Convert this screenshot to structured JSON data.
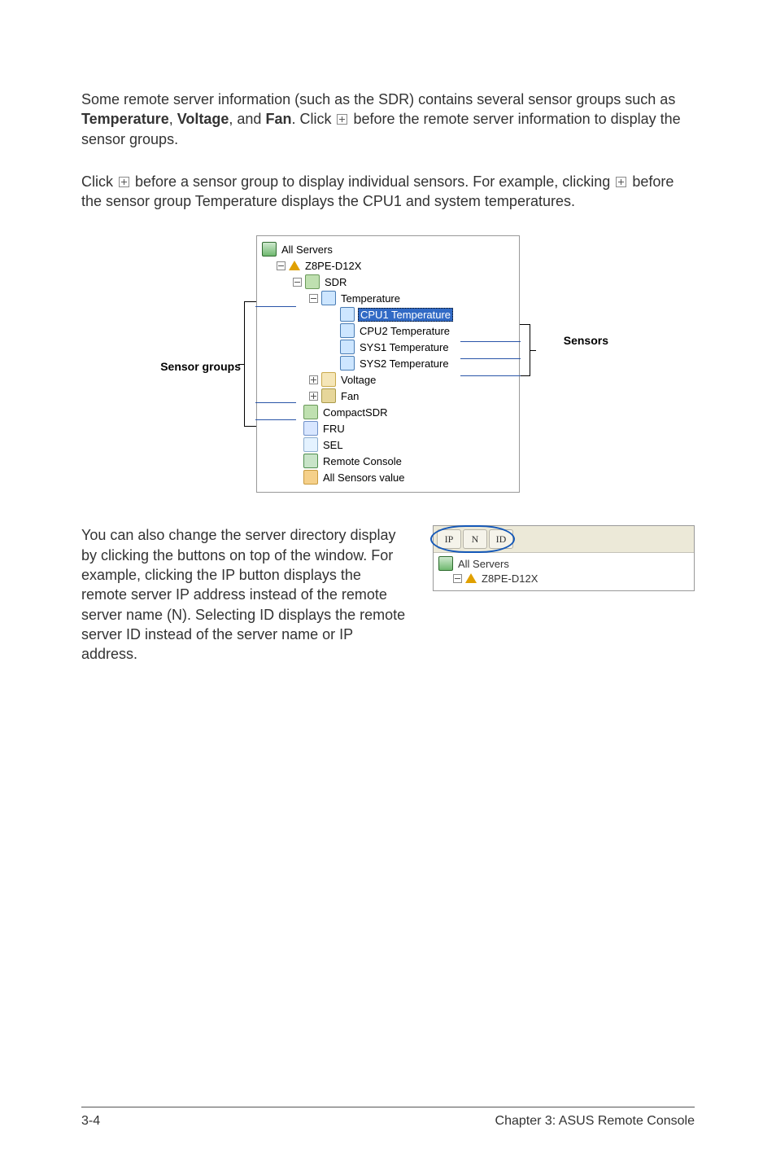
{
  "para1_pre": "Some remote server information (such as the SDR) contains several sensor groups such as ",
  "bold_temp": "Temperature",
  "sep1": ", ",
  "bold_volt": "Voltage",
  "sep2": ", and ",
  "bold_fan": "Fan",
  "para1_mid": ". Click ",
  "para1_post": " before the remote server information to display the sensor groups.",
  "para2_pre": "Click ",
  "para2_mid": " before a sensor group to display individual sensors. For example, clicking ",
  "para2_post": " before the sensor group Temperature displays the CPU1 and system temperatures.",
  "anno_left": "Sensor groups",
  "anno_right": "Sensors",
  "tree": {
    "root": "All Servers",
    "server": "Z8PE-D12X",
    "sdr": "SDR",
    "temperature": "Temperature",
    "cpu1": "CPU1 Temperature",
    "cpu2": "CPU2 Temperature",
    "sys1": "SYS1 Temperature",
    "sys2": "SYS2 Temperature",
    "voltage": "Voltage",
    "fan": "Fan",
    "compact": "CompactSDR",
    "fru": "FRU",
    "sel": "SEL",
    "remote": "Remote Console",
    "allsensors": "All Sensors value"
  },
  "para3": "You can also change the server directory display by clicking the buttons on top of the window. For example, clicking the IP button displays the remote server IP address instead of the remote server name (N). Selecting ID displays the remote server ID instead of the server name or IP address.",
  "btnbar": {
    "ip": "IP",
    "n": "N",
    "id": "ID"
  },
  "small_tree": {
    "root": "All Servers",
    "server": "Z8PE-D12X"
  },
  "footer_left": "3-4",
  "footer_right": "Chapter 3: ASUS Remote Console"
}
